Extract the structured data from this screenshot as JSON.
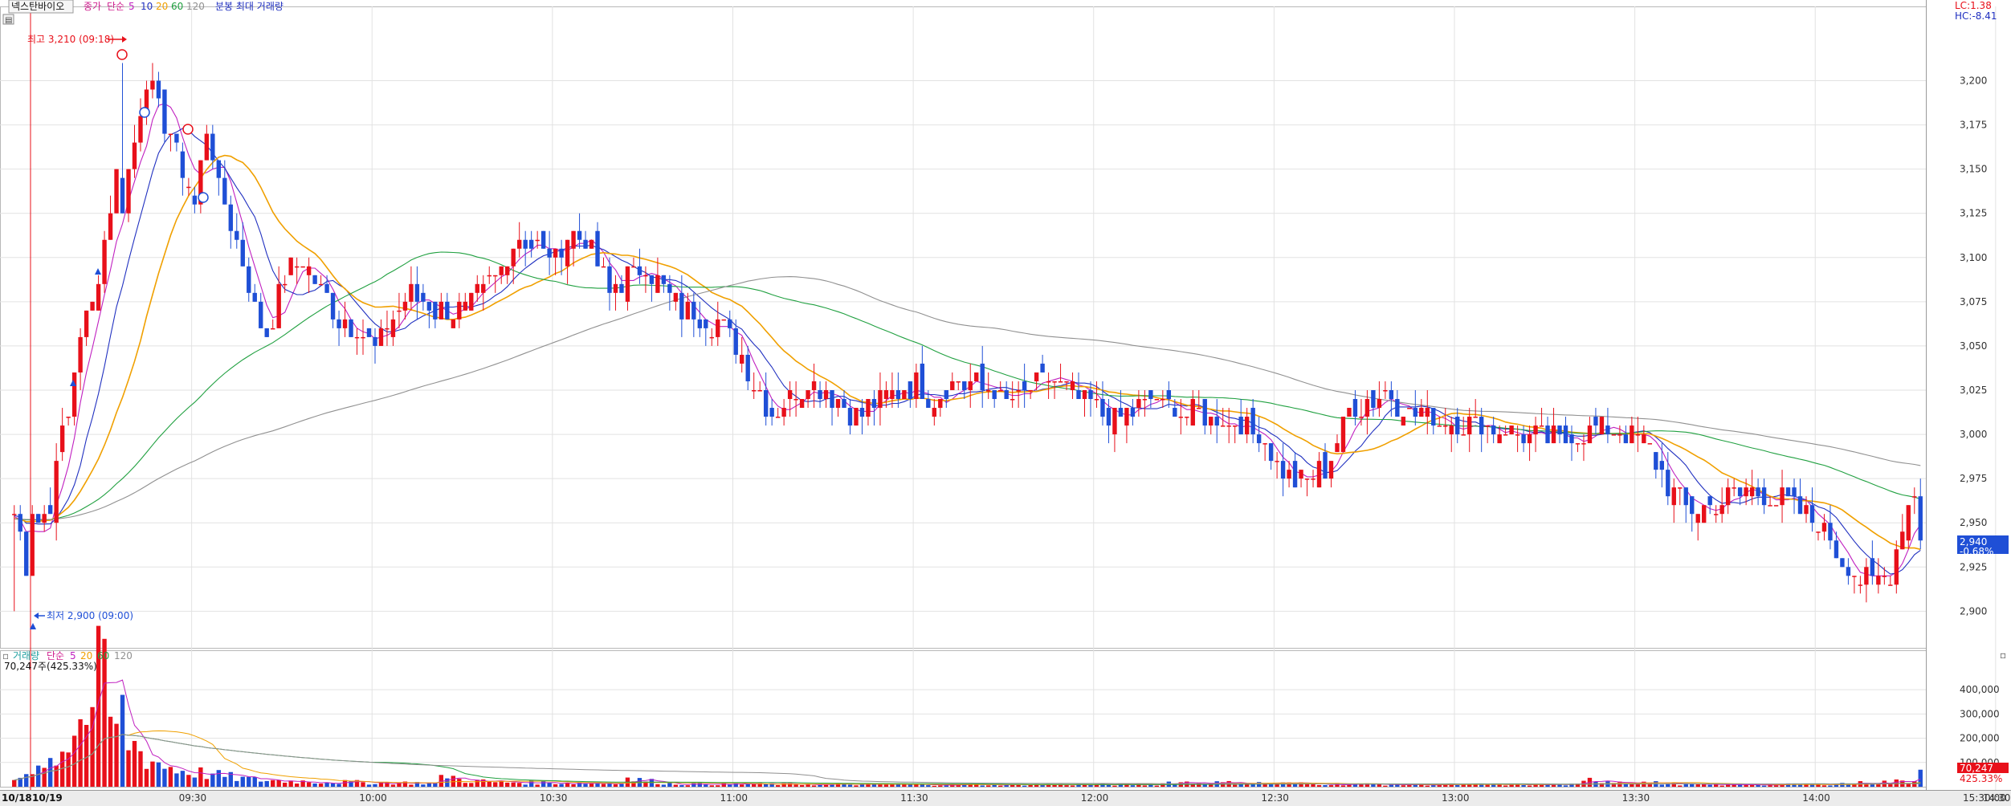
{
  "header": {
    "stock_name": "넥스탄바이오",
    "legend_prefix": "종가",
    "legend_kind": "단순",
    "ma_periods": [
      "5",
      "10",
      "20",
      "60",
      "120"
    ],
    "extra": "분봉 최대 거래량",
    "lc_text": "LC:1.38",
    "hc_text": "HC:-8.41"
  },
  "annotations": {
    "high_text": "최고 3,210 (09:18)",
    "low_text": "최저 2,900 (09:00)"
  },
  "volume_header": {
    "label": "거래량",
    "kind": "단순",
    "ma_periods": [
      "5",
      "20",
      "60",
      "120"
    ],
    "current_text": "70,247주(425.33%)"
  },
  "price_badge": {
    "value": "2,940",
    "change": "-0.68%"
  },
  "volume_badge": {
    "value": "70,247",
    "pct": "425.33%"
  },
  "x_axis": {
    "date_label": "10/18",
    "date_label2": "10/19",
    "end_label": "15:30:00"
  },
  "colors": {
    "up": "#e8101a",
    "down": "#1f4fd6",
    "ma5": "#c020c0",
    "ma10": "#2030c0",
    "ma20": "#f0a000",
    "ma60": "#20a040",
    "ma120": "#909090"
  },
  "chart_data": [
    {
      "type": "candlestick",
      "title": "넥스탄바이오",
      "y_ticks": [
        2900,
        2925,
        2950,
        2975,
        3000,
        3025,
        3050,
        3075,
        3100,
        3125,
        3150,
        3175,
        3200
      ],
      "ylim": [
        2887,
        3232
      ],
      "x_ticks": [
        "09:30",
        "10:00",
        "10:30",
        "11:00",
        "11:30",
        "12:00",
        "12:30",
        "13:00",
        "13:30",
        "14:00",
        "14:30",
        "15:00"
      ],
      "time_start": "09:00",
      "time_end": "15:30",
      "bars_per_tick": 30,
      "high": 3210,
      "high_time": "09:18",
      "low": 2900,
      "low_time": "09:00",
      "last": 2940,
      "series": [
        {
          "name": "5",
          "ma": 5
        },
        {
          "name": "10",
          "ma": 10
        },
        {
          "name": "20",
          "ma": 20
        },
        {
          "name": "60",
          "ma": 60
        },
        {
          "name": "120",
          "ma": 120
        }
      ],
      "close_anchors": [
        [
          0,
          2955
        ],
        [
          1,
          2945
        ],
        [
          2,
          2920
        ],
        [
          3,
          2960
        ],
        [
          4,
          2955
        ],
        [
          6,
          2955
        ],
        [
          7,
          2990
        ],
        [
          9,
          3010
        ],
        [
          11,
          3060
        ],
        [
          13,
          3075
        ],
        [
          15,
          3110
        ],
        [
          17,
          3150
        ],
        [
          18,
          3130
        ],
        [
          20,
          3165
        ],
        [
          22,
          3200
        ],
        [
          24,
          3185
        ],
        [
          26,
          3170
        ],
        [
          28,
          3150
        ],
        [
          30,
          3130
        ],
        [
          32,
          3175
        ],
        [
          34,
          3140
        ],
        [
          36,
          3120
        ],
        [
          38,
          3095
        ],
        [
          40,
          3070
        ],
        [
          42,
          3055
        ],
        [
          44,
          3080
        ],
        [
          46,
          3095
        ],
        [
          48,
          3100
        ],
        [
          50,
          3085
        ],
        [
          52,
          3080
        ],
        [
          54,
          3065
        ],
        [
          57,
          3060
        ],
        [
          60,
          3050
        ],
        [
          63,
          3065
        ],
        [
          66,
          3080
        ],
        [
          69,
          3072
        ],
        [
          72,
          3068
        ],
        [
          75,
          3070
        ],
        [
          78,
          3080
        ],
        [
          81,
          3095
        ],
        [
          84,
          3110
        ],
        [
          87,
          3105
        ],
        [
          90,
          3100
        ],
        [
          93,
          3115
        ],
        [
          96,
          3105
        ],
        [
          99,
          3080
        ],
        [
          102,
          3090
        ],
        [
          105,
          3095
        ],
        [
          108,
          3080
        ],
        [
          111,
          3070
        ],
        [
          114,
          3068
        ],
        [
          117,
          3062
        ],
        [
          120,
          3050
        ],
        [
          123,
          3030
        ],
        [
          126,
          3010
        ],
        [
          129,
          3020
        ],
        [
          132,
          3030
        ],
        [
          135,
          3025
        ],
        [
          138,
          3015
        ],
        [
          141,
          3012
        ],
        [
          144,
          3020
        ],
        [
          147,
          3024
        ],
        [
          150,
          3028
        ],
        [
          153,
          3020
        ],
        [
          156,
          3030
        ],
        [
          159,
          3028
        ],
        [
          162,
          3025
        ],
        [
          165,
          3020
        ],
        [
          168,
          3022
        ],
        [
          171,
          3030
        ],
        [
          174,
          3028
        ],
        [
          177,
          3020
        ],
        [
          180,
          3015
        ],
        [
          183,
          3010
        ],
        [
          186,
          3012
        ],
        [
          189,
          3020
        ],
        [
          192,
          3015
        ],
        [
          195,
          3012
        ],
        [
          198,
          3010
        ],
        [
          201,
          3008
        ],
        [
          204,
          3005
        ],
        [
          207,
          3000
        ],
        [
          210,
          2985
        ],
        [
          213,
          2972
        ],
        [
          216,
          2975
        ],
        [
          219,
          2985
        ],
        [
          222,
          3012
        ],
        [
          225,
          3018
        ],
        [
          228,
          3025
        ],
        [
          231,
          3015
        ],
        [
          234,
          3012
        ],
        [
          237,
          3008
        ],
        [
          240,
          3008
        ],
        [
          243,
          3006
        ],
        [
          246,
          3004
        ],
        [
          249,
          3003
        ],
        [
          252,
          3000
        ],
        [
          255,
          2997
        ],
        [
          258,
          2998
        ],
        [
          261,
          3001
        ],
        [
          264,
          3002
        ],
        [
          267,
          3001
        ],
        [
          270,
          3000
        ],
        [
          273,
          2985
        ],
        [
          276,
          2965
        ],
        [
          279,
          2955
        ],
        [
          282,
          2958
        ],
        [
          285,
          2965
        ],
        [
          288,
          2968
        ],
        [
          291,
          2965
        ],
        [
          294,
          2962
        ],
        [
          297,
          2955
        ],
        [
          300,
          2950
        ],
        [
          303,
          2935
        ],
        [
          306,
          2920
        ],
        [
          309,
          2916
        ],
        [
          312,
          2920
        ],
        [
          314,
          2950
        ],
        [
          316,
          2968
        ],
        [
          317,
          2960
        ]
      ]
    },
    {
      "type": "bar",
      "title": "거래량",
      "y_ticks": [
        100000,
        200000,
        300000,
        400000
      ],
      "ylim": [
        0,
        470000
      ],
      "volume_anchors": [
        [
          0,
          30000
        ],
        [
          2,
          60000
        ],
        [
          4,
          120000
        ],
        [
          5,
          80000
        ],
        [
          7,
          150000
        ],
        [
          9,
          200000
        ],
        [
          11,
          330000
        ],
        [
          12,
          250000
        ],
        [
          13,
          420000
        ],
        [
          14,
          460000
        ],
        [
          15,
          440000
        ],
        [
          16,
          300000
        ],
        [
          17,
          250000
        ],
        [
          18,
          310000
        ],
        [
          19,
          200000
        ],
        [
          20,
          180000
        ],
        [
          22,
          130000
        ],
        [
          25,
          90000
        ],
        [
          28,
          70000
        ],
        [
          31,
          60000
        ],
        [
          35,
          45000
        ],
        [
          40,
          30000
        ],
        [
          50,
          22000
        ],
        [
          60,
          18000
        ],
        [
          70,
          16000
        ],
        [
          72,
          55000
        ],
        [
          74,
          30000
        ],
        [
          80,
          20000
        ],
        [
          100,
          15000
        ],
        [
          102,
          35000
        ],
        [
          110,
          12000
        ],
        [
          150,
          9000
        ],
        [
          190,
          9000
        ],
        [
          192,
          20000
        ],
        [
          230,
          9000
        ],
        [
          260,
          9000
        ],
        [
          262,
          30000
        ],
        [
          280,
          8000
        ],
        [
          300,
          10000
        ],
        [
          316,
          25000
        ],
        [
          317,
          70247
        ]
      ]
    }
  ]
}
